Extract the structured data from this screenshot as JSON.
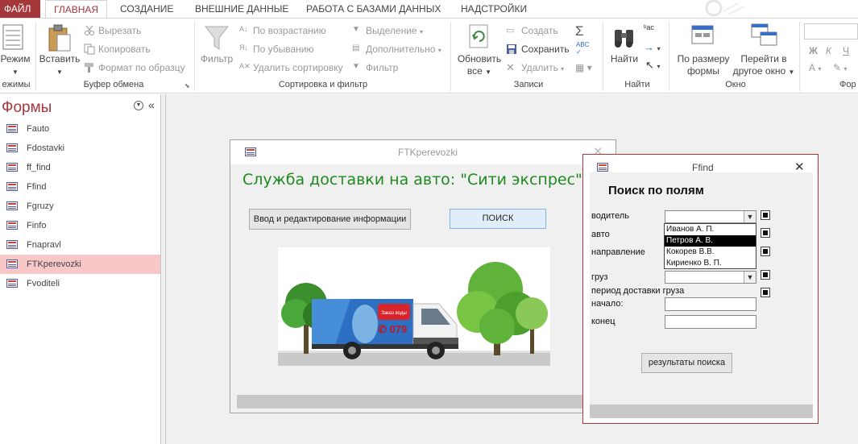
{
  "ribbon_tabs": {
    "file": "ФАЙЛ",
    "home": "ГЛАВНАЯ",
    "create": "СОЗДАНИЕ",
    "external": "ВНЕШНИЕ ДАННЫЕ",
    "database": "РАБОТА С БАЗАМИ ДАННЫХ",
    "addins": "НАДСТРОЙКИ"
  },
  "ribbon": {
    "views": {
      "button": "Режим",
      "group": "ежимы"
    },
    "clipboard": {
      "paste": "Вставить",
      "cut": "Вырезать",
      "copy": "Копировать",
      "format_painter": "Формат по образцу",
      "group": "Буфер обмена"
    },
    "sort_filter": {
      "filter": "Фильтр",
      "ascending": "По возрастанию",
      "descending": "По убыванию",
      "remove_sort": "Удалить сортировку",
      "selection": "Выделение",
      "advanced": "Дополнительно",
      "toggle_filter": "Фильтр",
      "group": "Сортировка и фильтр"
    },
    "records": {
      "refresh_line1": "Обновить",
      "refresh_line2": "все",
      "new": "Создать",
      "save": "Сохранить",
      "delete": "Удалить",
      "group": "Записи"
    },
    "find": {
      "find": "Найти",
      "group": "Найти"
    },
    "window": {
      "fit_line1": "По размеру",
      "fit_line2": "формы",
      "switch_line1": "Перейти в",
      "switch_line2": "другое окно",
      "group": "Окно"
    },
    "text_formatting": {
      "bold": "Ж",
      "italic": "К",
      "underline": "Ч",
      "font_color": "А",
      "group": "Фор"
    }
  },
  "nav_pane": {
    "title": "Формы",
    "items": [
      "Fauto",
      "Fdostavki",
      "ff_find",
      "Ffind",
      "Fgruzy",
      "Finfo",
      "Fnapravl",
      "FTKperevozki",
      "Fvoditeli"
    ],
    "selected": "FTKperevozki"
  },
  "form_main": {
    "title": "FTKperevozki",
    "heading": "Служба доставки на авто: \"Сити экспрес\"",
    "button_edit": "Ввод и редактирование информации",
    "button_search": "ПОИСК",
    "truck_sign": "Заказ воды",
    "truck_number": "079"
  },
  "form_find": {
    "title": "Ffind",
    "heading": "Поиск по полям",
    "labels": {
      "driver": "водитель",
      "auto": "авто",
      "direction": "направление",
      "cargo": "груз",
      "period": "период доставки груза",
      "start": "начало:",
      "end": "конец"
    },
    "dropdown_options": [
      "Иванов А. П.",
      "Петров А. В.",
      "Кокорев В.В.",
      "Кириенко В. П."
    ],
    "dropdown_highlighted": "Петров А. В.",
    "button_results": "результаты поиска"
  },
  "colors": {
    "accent": "#a4373a",
    "heading_green": "#1f8a1f",
    "nav_selected": "#f8c8c9"
  }
}
